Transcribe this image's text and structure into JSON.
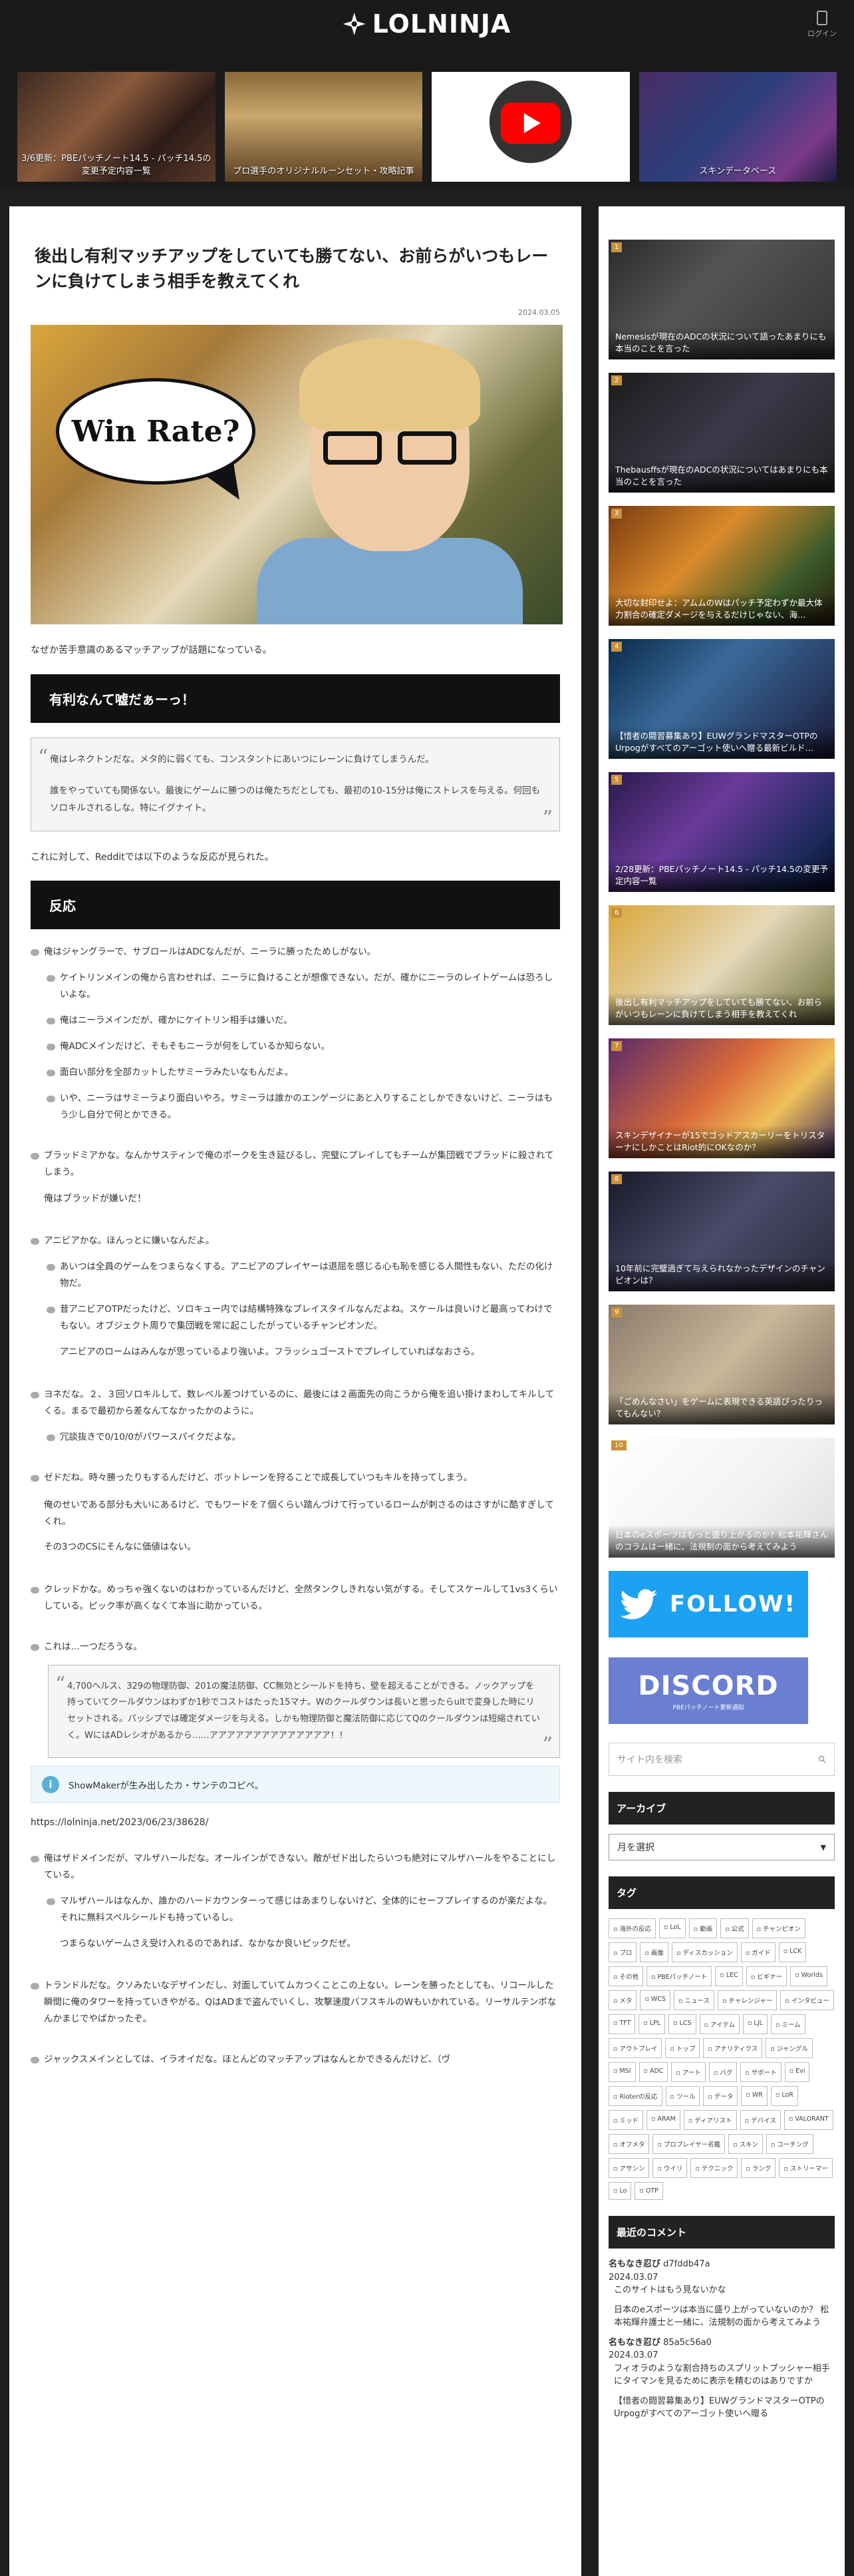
{
  "header": {
    "site_name": "LOLNINJA",
    "login_label": "ログイン"
  },
  "banners": [
    {
      "caption": "3/6更新：PBEパッチノート14.5 - パッチ14.5の変更予定内容一覧"
    },
    {
      "caption": "プロ選手のオリジナルルーンセット・攻略記事"
    },
    {
      "caption": "YouTubeチャンネル"
    },
    {
      "caption": "スキンデータベース"
    }
  ],
  "article": {
    "title": "後出し有利マッチアップをしていても勝てない、お前らがいつもレーンに負けてしまう相手を教えてくれ",
    "date": "2024.03.05",
    "hero_text": "Win Rate?",
    "intro": "なぜか苦手意識のあるマッチアップが話題になっている。",
    "heading1": "有利なんて嘘だぁーっ！",
    "quote1_p1": "俺はレネクトンだな。メタ的に弱くても、コンスタントにあいつにレーンに負けてしまうんだ。",
    "quote1_p2": "誰をやっていても関係ない。最後にゲームに勝つのは俺たちだとしても、最初の10-15分は俺にストレスを与える。何回もソロキルされるしな。特にイグナイト。",
    "after_quote": "これに対して、Redditでは以下のような反応が見られた。",
    "heading2": "反応",
    "c1": "俺はジャングラーで、サブロールはADCなんだが、ニーラに勝ったためしがない。",
    "c1a": "ケイトリンメインの俺から言わせれば、ニーラに負けることが想像できない。だが、確かにニーラのレイトゲームは恐ろしいよな。",
    "c1b": "俺はニーラメインだが、確かにケイトリン相手は嫌いだ。",
    "c1c": "俺ADCメインだけど、そもそもニーラが何をしているか知らない。",
    "c1d": "面白い部分を全部カットしたサミーラみたいなもんだよ。",
    "c1e": "いや、ニーラはサミーラより面白いやろ。サミーラは誰かのエンゲージにあと入りすることしかできないけど、ニーラはもう少し自分で何とかできる。",
    "c2": "ブラッドミアかな。なんかサスティンで俺のポークを生き延びるし、完璧にプレイしてもチームが集団戦でブラッドに殺されてしまう。",
    "c2b": "俺はブラッドが嫌いだ！",
    "c3": "アニビアかな。ほんっとに嫌いなんだよ。",
    "c3a": "あいつは全員のゲームをつまらなくする。アニビアのプレイヤーは退屈を感じる心も恥を感じる人間性もない、ただの化け物だ。",
    "c3b": "昔アニビアOTPだったけど、ソロキュー内では結構特殊なプレイスタイルなんだよね。スケールは良いけど最高ってわけでもない。オブジェクト周りで集団戦を常に起こしたがっているチャンピオンだ。",
    "c3c": "アニビアのロームはみんなが思っているより強いよ。フラッシュゴーストでプレイしていればなおさら。",
    "c4": "ヨネだな。２、３回ソロキルして、数レベル差つけているのに、最後には２画面先の向こうから俺を追い掛けまわしてキルしてくる。まるで最初から差なんてなかったかのように。",
    "c4a": "冗談抜きで0/10/0がパワースパイクだよな。",
    "c5": "ゼドだね。時々勝ったりもするんだけど、ボットレーンを狩ることで成長していつもキルを持ってしまう。",
    "c5b": "俺のせいである部分も大いにあるけど、でもワードを７個くらい踏んづけて行っているロームが刺さるのはさすがに酷すぎしてくれ。",
    "c5c": "その3つのCSにそんなに価値はない。",
    "c6": "クレッドかな。めっちゃ強くないのはわかっているんだけど、全然タンクしきれない気がする。そしてスケールして1vs3くらいしている。ピック率が高くなくて本当に助かっている。",
    "c7": "これは…一つだろうな。",
    "quote2": "4,700ヘルス、329の物理防御、201の魔法防御、CC無効とシールドを持ち、壁を超えることができる。ノックアップを持っていてクールダウンはわずか1秒でコストはたった15マナ。Wのクールダウンは長いと思ったらultで変身した時にリセットされる。パッシブでは確定ダメージを与える。しかも物理防御と魔法防御に応じてQのクールダウンは短縮されていく。WにはADレシオがあるから……アアアアアアアアアアアアアア！！",
    "info_text": "ShowMakerが生み出したカ・サンテのコピペ。",
    "link": "https://lolninja.net/2023/06/23/38628/",
    "c8": "俺はザドメインだが、マルザハールだな。オールインができない。敵がゼド出したらいつも絶対にマルザハールをやることにしている。",
    "c8a": "マルザハールはなんか、誰かのハードカウンターって感じはあまりしないけど、全体的にセーフプレイするのが楽だよな。それに無料スペルシールドも持っているし。",
    "c8b": "つまらないゲームさえ受け入れるのであれば、なかなか良いピックだぜ。",
    "c9": "トランドルだな。クソみたいなデザインだし、対面していてムカつくことこの上ない。レーンを勝ったとしても、リコールした瞬間に俺のタワーを持っていきやがる。QはADまで盗んでいくし、攻撃速度バフスキルのWもいかれている。リーサルテンポなんかまじでやばかったぞ。",
    "c10": "ジャックスメインとしては、イラオイだな。ほとんどのマッチアップはなんとかできるんだけど、（ヴ"
  },
  "sidebar": {
    "ranking": [
      {
        "rank": "1",
        "caption": "Nemesisが現在のADCの状況について語ったあまりにも本当のことを言った"
      },
      {
        "rank": "2",
        "caption": "Thebausffsが現在のADCの状況についてはあまりにも本当のことを言った"
      },
      {
        "rank": "3",
        "caption": "大切な封印せよ：アムムのWはパッチ予定わずか最大体力割合の確定ダメージを与えるだけじゃない、海…"
      },
      {
        "rank": "4",
        "caption": "【惜者の闘習募集あり】EUWグランドマスターOTPのUrpogがすべてのアーゴット使いへ贈る最新ビルド…"
      },
      {
        "rank": "5",
        "caption": "2/28更新：PBEパッチノート14.5 - パッチ14.5の変更予定内容一覧"
      },
      {
        "rank": "6",
        "caption": "後出し有利マッチアップをしていても勝てない、お前らがいつもレーンに負けてしまう相手を教えてくれ"
      },
      {
        "rank": "7",
        "caption": "スキンデザイナーが15でゴッドアスカーリーをトリスターナにしかことはRiot的にOKなのか？"
      },
      {
        "rank": "8",
        "caption": "10年前に完璧過ぎて与えられなかったデザインのチャンピオンは？"
      },
      {
        "rank": "9",
        "caption": "「ごめんなさい」をゲームに表現できる英語ぴったりってもんない？"
      },
      {
        "rank": "10",
        "caption": "日本のeスポーツはもっと盛り上がるのか？松本祐輝さんのコラムは一緒に、法規制の面から考えてみよう"
      }
    ],
    "twitter_label": "FOLLOW!",
    "discord_label": "DISCORD",
    "discord_sub": "PBEパッチノート更新通知",
    "search_placeholder": "サイト内を検索",
    "archive_title": "アーカイブ",
    "archive_select": "月を選択",
    "tags_title": "タグ",
    "tags": [
      "海外の反応",
      "LoL",
      "動画",
      "公式",
      "チャンピオン",
      "プロ",
      "画像",
      "ディスカッション",
      "ガイド",
      "LCK",
      "その他",
      "PBEパッチノート",
      "LEC",
      "ビギナー",
      "Worlds",
      "メタ",
      "WCS",
      "ニュース",
      "チャレンジャー",
      "インタビュー",
      "TFT",
      "LPL",
      "LCS",
      "アイテム",
      "LJL",
      "ミーム",
      "アウトプレイ",
      "トップ",
      "アナリティクス",
      "ジャングル",
      "MSI",
      "ADC",
      "アート",
      "バグ",
      "サポート",
      "Evi",
      "Rioterの反応",
      "ツール",
      "データ",
      "WR",
      "LoR",
      "ミッド",
      "ARAM",
      "ディアリスト",
      "デバイス",
      "VALORANT",
      "オフメタ",
      "プロプレイヤー名鑑",
      "スキン",
      "コーチング",
      "アサシン",
      "ウイリ",
      "テクニック",
      "ランク",
      "ストリーマー",
      "Lo",
      "OTP"
    ],
    "recent_title": "最近のコメント",
    "recent": [
      {
        "who": "名もなき忍び",
        "id": "d7fddb47a",
        "date": "2024.03.07",
        "text": "このサイトはもう見ないかな"
      },
      {
        "who": "",
        "id": "",
        "date": "",
        "text": "日本のeスポーツは本当に盛り上がっていないのか？ 松本祐輝弁護士と一緒に、法規制の面から考えてみよう"
      },
      {
        "who": "名もなき忍び",
        "id": "85a5c56a0",
        "date": "2024.03.07",
        "text": "フィオラのような割合持ちのスプリットプッシャー相手にタイマンを見るために表示を精むのはありですか"
      },
      {
        "who": "",
        "id": "",
        "date": "",
        "text": "【惜者の闘習募集あり】EUWグランドマスターOTPのUrpogがすべてのアーゴット使いへ贈る"
      }
    ]
  }
}
